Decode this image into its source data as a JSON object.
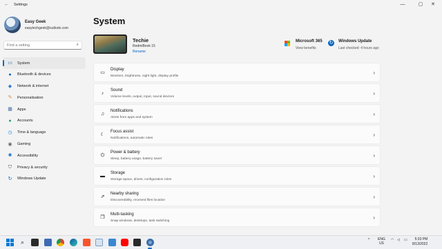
{
  "window": {
    "title": "Settings",
    "controls": [
      "minimize",
      "maximize",
      "close"
    ]
  },
  "profile": {
    "name": "Easy Geek",
    "email": "easytechgeek@outlook.com"
  },
  "search": {
    "placeholder": "Find a setting",
    "value": ""
  },
  "sidebar": {
    "items": [
      {
        "label": "System",
        "icon": "system-icon",
        "active": true
      },
      {
        "label": "Bluetooth & devices",
        "icon": "bluetooth-icon"
      },
      {
        "label": "Network & internet",
        "icon": "network-icon"
      },
      {
        "label": "Personalisation",
        "icon": "brush-icon"
      },
      {
        "label": "Apps",
        "icon": "apps-icon"
      },
      {
        "label": "Accounts",
        "icon": "accounts-icon"
      },
      {
        "label": "Time & language",
        "icon": "clock-icon"
      },
      {
        "label": "Gaming",
        "icon": "gaming-icon"
      },
      {
        "label": "Accessibility",
        "icon": "accessibility-icon"
      },
      {
        "label": "Privacy & security",
        "icon": "shield-icon"
      },
      {
        "label": "Windows Update",
        "icon": "update-icon"
      }
    ]
  },
  "page": {
    "title": "System"
  },
  "device": {
    "name": "Techie",
    "model": "RedmiBook 15",
    "rename_label": "Rename"
  },
  "microsoft365": {
    "title": "Microsoft 365",
    "subtitle": "View benefits"
  },
  "windows_update": {
    "title": "Windows Update",
    "subtitle": "Last checked: 4 hours ago"
  },
  "settings_cards": [
    {
      "title": "Display",
      "subtitle": "Monitors, brightness, night light, display profile",
      "icon": "display-icon"
    },
    {
      "title": "Sound",
      "subtitle": "Volume levels, output, input, sound devices",
      "icon": "sound-icon"
    },
    {
      "title": "Notifications",
      "subtitle": "Alerts from apps and system",
      "icon": "bell-icon"
    },
    {
      "title": "Focus assist",
      "subtitle": "Notifications, automatic rules",
      "icon": "moon-icon"
    },
    {
      "title": "Power & battery",
      "subtitle": "Sleep, battery usage, battery saver",
      "icon": "power-icon"
    },
    {
      "title": "Storage",
      "subtitle": "Storage space, drives, configuration rules",
      "icon": "storage-icon"
    },
    {
      "title": "Nearby sharing",
      "subtitle": "Discoverability, received files location",
      "icon": "share-icon"
    },
    {
      "title": "Multi-tasking",
      "subtitle": "Snap windows, desktops, task switching",
      "icon": "multitask-icon"
    }
  ],
  "taskbar": {
    "apps": [
      "windows-start-icon",
      "search-icon",
      "task-view-icon",
      "widgets-icon",
      "chrome-icon",
      "edge-icon",
      "brave-icon",
      "mail-icon",
      "photos-icon",
      "youtube-icon",
      "store-icon",
      "settings-icon"
    ],
    "tray": {
      "lang_top": "ENG",
      "lang_bottom": "US",
      "time": "5:33 PM",
      "date": "8/13/2022"
    }
  },
  "colors": {
    "accent": "#0067c0",
    "background": "#f3f3f3",
    "card": "#fbfbfb"
  }
}
